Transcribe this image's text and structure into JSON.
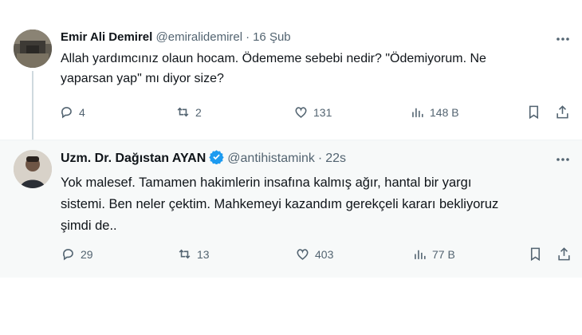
{
  "tweets": [
    {
      "name": "Emir Ali Demirel",
      "handle": "@emiralidemirel",
      "time": "16 Şub",
      "text_lines": [
        "Allah yardımcınız olaun hocam. Ödememe sebebi nedir? \"Ödemiyorum. Ne",
        "yaparsan yap\" mı diyor size?"
      ],
      "replies": "4",
      "retweets": "2",
      "likes": "131",
      "views": "148 B"
    },
    {
      "name": "Uzm. Dr. Dağıstan AYAN",
      "handle": "@antihistamink",
      "time": "22s",
      "verified_color": "#1d9bf0",
      "text_lines": [
        "Yok malesef. Tamamen hakimlerin insafına kalmış ağır, hantal bir yargı",
        "sistemi. Ben neler çektim. Mahkemeyi kazandım gerekçeli kararı bekliyoruz",
        "şimdi de.."
      ],
      "replies": "29",
      "retweets": "13",
      "likes": "403",
      "views": "77 B"
    }
  ],
  "icons": [
    "more-icon",
    "reply-icon",
    "retweet-icon",
    "like-icon",
    "views-icon",
    "bookmark-icon",
    "share-icon",
    "verified-badge-icon"
  ]
}
